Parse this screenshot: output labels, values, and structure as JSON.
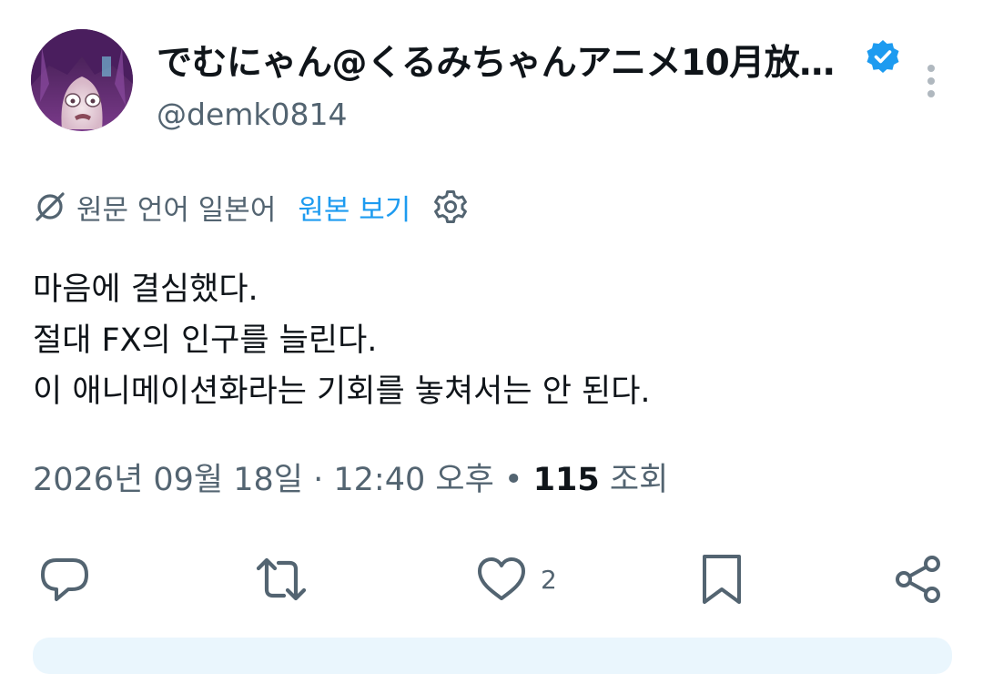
{
  "tweet": {
    "author": {
      "display_name": "でむにゃん@くるみちゃんアニメ10月放…",
      "handle": "@demk0814",
      "verified": true
    },
    "translation": {
      "source_language_label": "원문 언어 일본어",
      "show_original_label": "원본 보기"
    },
    "text_lines": [
      "마음에 결심했다.",
      "절대 FX의 인구를 늘린다.",
      "이 애니메이션화라는 기회를 놓쳐서는 안 된다."
    ],
    "meta": {
      "date": "2026년 09월 18일",
      "separator1": " · ",
      "time": "12:40 오후",
      "separator2": " • ",
      "views_count": "115",
      "views_label": " 조회"
    },
    "actions": {
      "like_count": "2"
    }
  },
  "icons": {
    "verified": "verified-badge-icon",
    "more": "more-vertical-icon",
    "translate": "translate-slash-icon",
    "settings": "gear-icon",
    "reply": "reply-icon",
    "retweet": "retweet-icon",
    "like": "heart-icon",
    "bookmark": "bookmark-icon",
    "share": "share-icon"
  },
  "colors": {
    "accent": "#1d9bf0",
    "secondary_text": "#536471",
    "primary_text": "#0f1419"
  }
}
